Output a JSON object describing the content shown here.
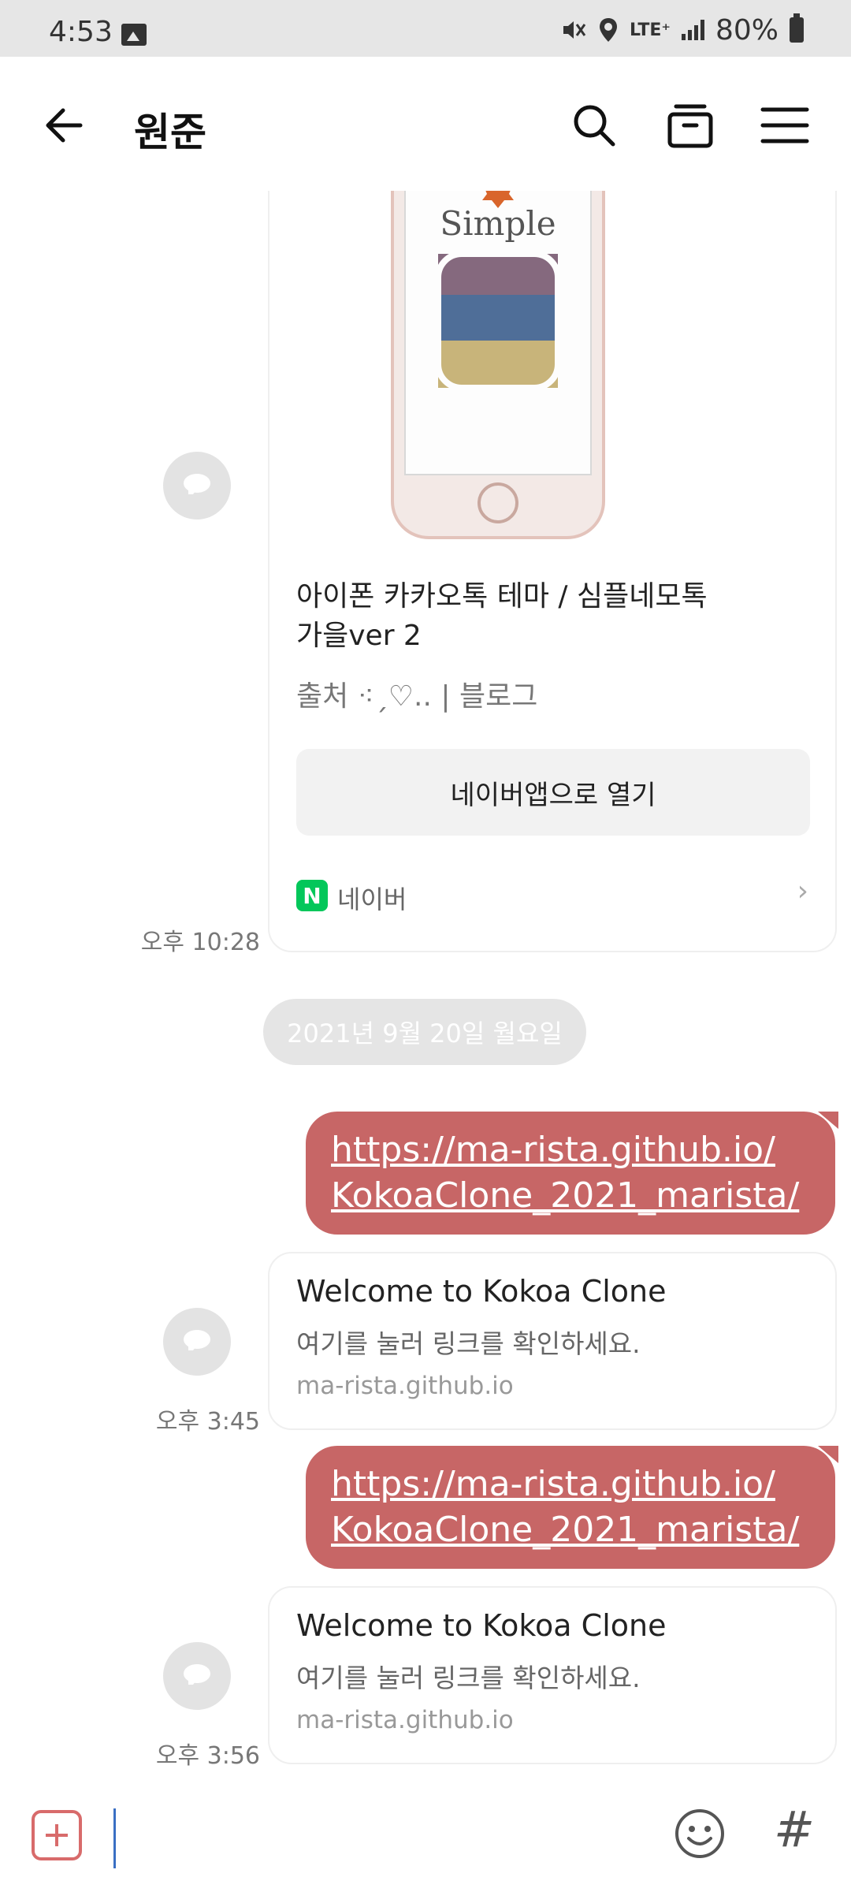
{
  "status_bar": {
    "time": "4:53",
    "network": "LTE⁺",
    "battery": "80%"
  },
  "header": {
    "title": "원준"
  },
  "messages": {
    "card1": {
      "image_text": "Simple",
      "title_line1": "아이폰 카카오톡 테마 / 심플네모톡",
      "title_line2": "가을ver 2",
      "source": "출처 ⁖ˏ♡.. | 블로그",
      "open_button": "네이버앱으로 열기",
      "provider_logo": "N",
      "provider": "네이버",
      "chevron": "›",
      "time": "오후 10:28"
    },
    "date_divider": "2021년 9월 20일 월요일",
    "sent1": {
      "line1": "https://ma-rista.github.io/",
      "line2": "KokoaClone_2021_marista/"
    },
    "preview1": {
      "title": "Welcome to Kokoa Clone",
      "desc": "여기를 눌러 링크를 확인하세요.",
      "domain": "ma-rista.github.io",
      "time": "오후 3:45"
    },
    "sent2": {
      "line1": "https://ma-rista.github.io/",
      "line2": "KokoaClone_2021_marista/"
    },
    "preview2": {
      "title": "Welcome to Kokoa Clone",
      "desc": "여기를 눌러 링크를 확인하세요.",
      "domain": "ma-rista.github.io",
      "time": "오후 3:56"
    }
  },
  "input_bar": {
    "hash": "#"
  },
  "colors": {
    "sent_bubble": "#c76666",
    "naver_green": "#03c75a",
    "plus_accent": "#d86b6b"
  },
  "icons": [
    "gallery-icon",
    "mute-icon",
    "location-icon",
    "signal-icon",
    "battery-icon",
    "back-arrow-icon",
    "search-icon",
    "drawer-icon",
    "menu-icon",
    "plus-icon",
    "emoji-icon",
    "hash-icon"
  ]
}
